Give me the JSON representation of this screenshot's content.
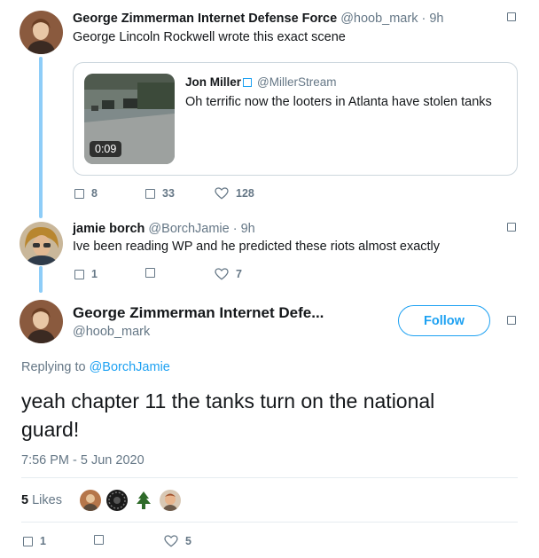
{
  "tweet1": {
    "name": "George Zimmerman Internet Defense Force",
    "handle": "@hoob_mark",
    "separator": "·",
    "time": "9h",
    "text": "George Lincoln Rockwell wrote this exact scene",
    "quote": {
      "name": "Jon Miller",
      "handle": "@MillerStream",
      "text": "Oh terrific now the looters in Atlanta have stolen tanks",
      "duration": "0:09"
    },
    "replies": "8",
    "retweets": "33",
    "likes": "128"
  },
  "tweet2": {
    "name": "jamie borch",
    "handle": "@BorchJamie",
    "separator": "·",
    "time": "9h",
    "text": "Ive been reading WP and he predicted these riots almost exactly",
    "replies": "1",
    "retweets": "",
    "likes": "7"
  },
  "main": {
    "name": "George Zimmerman Internet Defe...",
    "handle": "@hoob_mark",
    "follow_label": "Follow",
    "replying_prefix": "Replying to",
    "replying_to": "@BorchJamie",
    "text": "yeah chapter 11 the tanks turn on the national guard!",
    "timestamp": "7:56 PM - 5 Jun 2020",
    "likes_count": "5",
    "likes_label": "Likes",
    "replies": "1",
    "retweets": "",
    "likes": "5"
  },
  "colors": {
    "accent": "#1da1f2",
    "thread_line": "#8ecdf8",
    "muted": "#657786"
  }
}
